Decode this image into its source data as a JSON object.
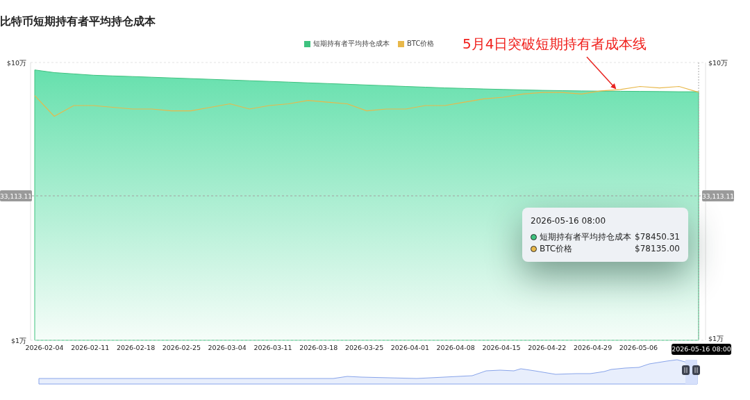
{
  "title": "比特币短期持有者平均持仓成本",
  "chart": {
    "legend": [
      {
        "name": "短期持有者平均持仓成本",
        "color": "#3ec27f"
      },
      {
        "name": "BTC价格",
        "color": "#e8b84a"
      }
    ],
    "annotation": "5月4日突破短期持有者成本线",
    "left_axis_labels": [
      "$10万",
      "$1万"
    ],
    "right_axis_labels": [
      "$10万",
      "$1万"
    ],
    "x_axis_labels": [
      "2026-02-04",
      "2026-02-11",
      "2026-02-18",
      "2026-02-25",
      "2026-03-04",
      "2026-03-11",
      "2026-03-18",
      "2026-03-25",
      "2026-04-01",
      "2026-04-08",
      "2026-04-15",
      "2026-04-22",
      "2026-04-29",
      "2026-05-06"
    ],
    "crosshair": {
      "x_label": "2026-05-16 08:00",
      "y_labels": [
        "33,113.11",
        "33,113.11"
      ]
    },
    "tooltip": {
      "date": "2026-05-16 08:00",
      "rows": [
        {
          "label": "短期持有者平均持仓成本",
          "value": "$78450.31",
          "color": "#3ec27f"
        },
        {
          "label": "BTC价格",
          "value": "$78135.00",
          "color": "#e8b84a"
        }
      ]
    }
  }
}
